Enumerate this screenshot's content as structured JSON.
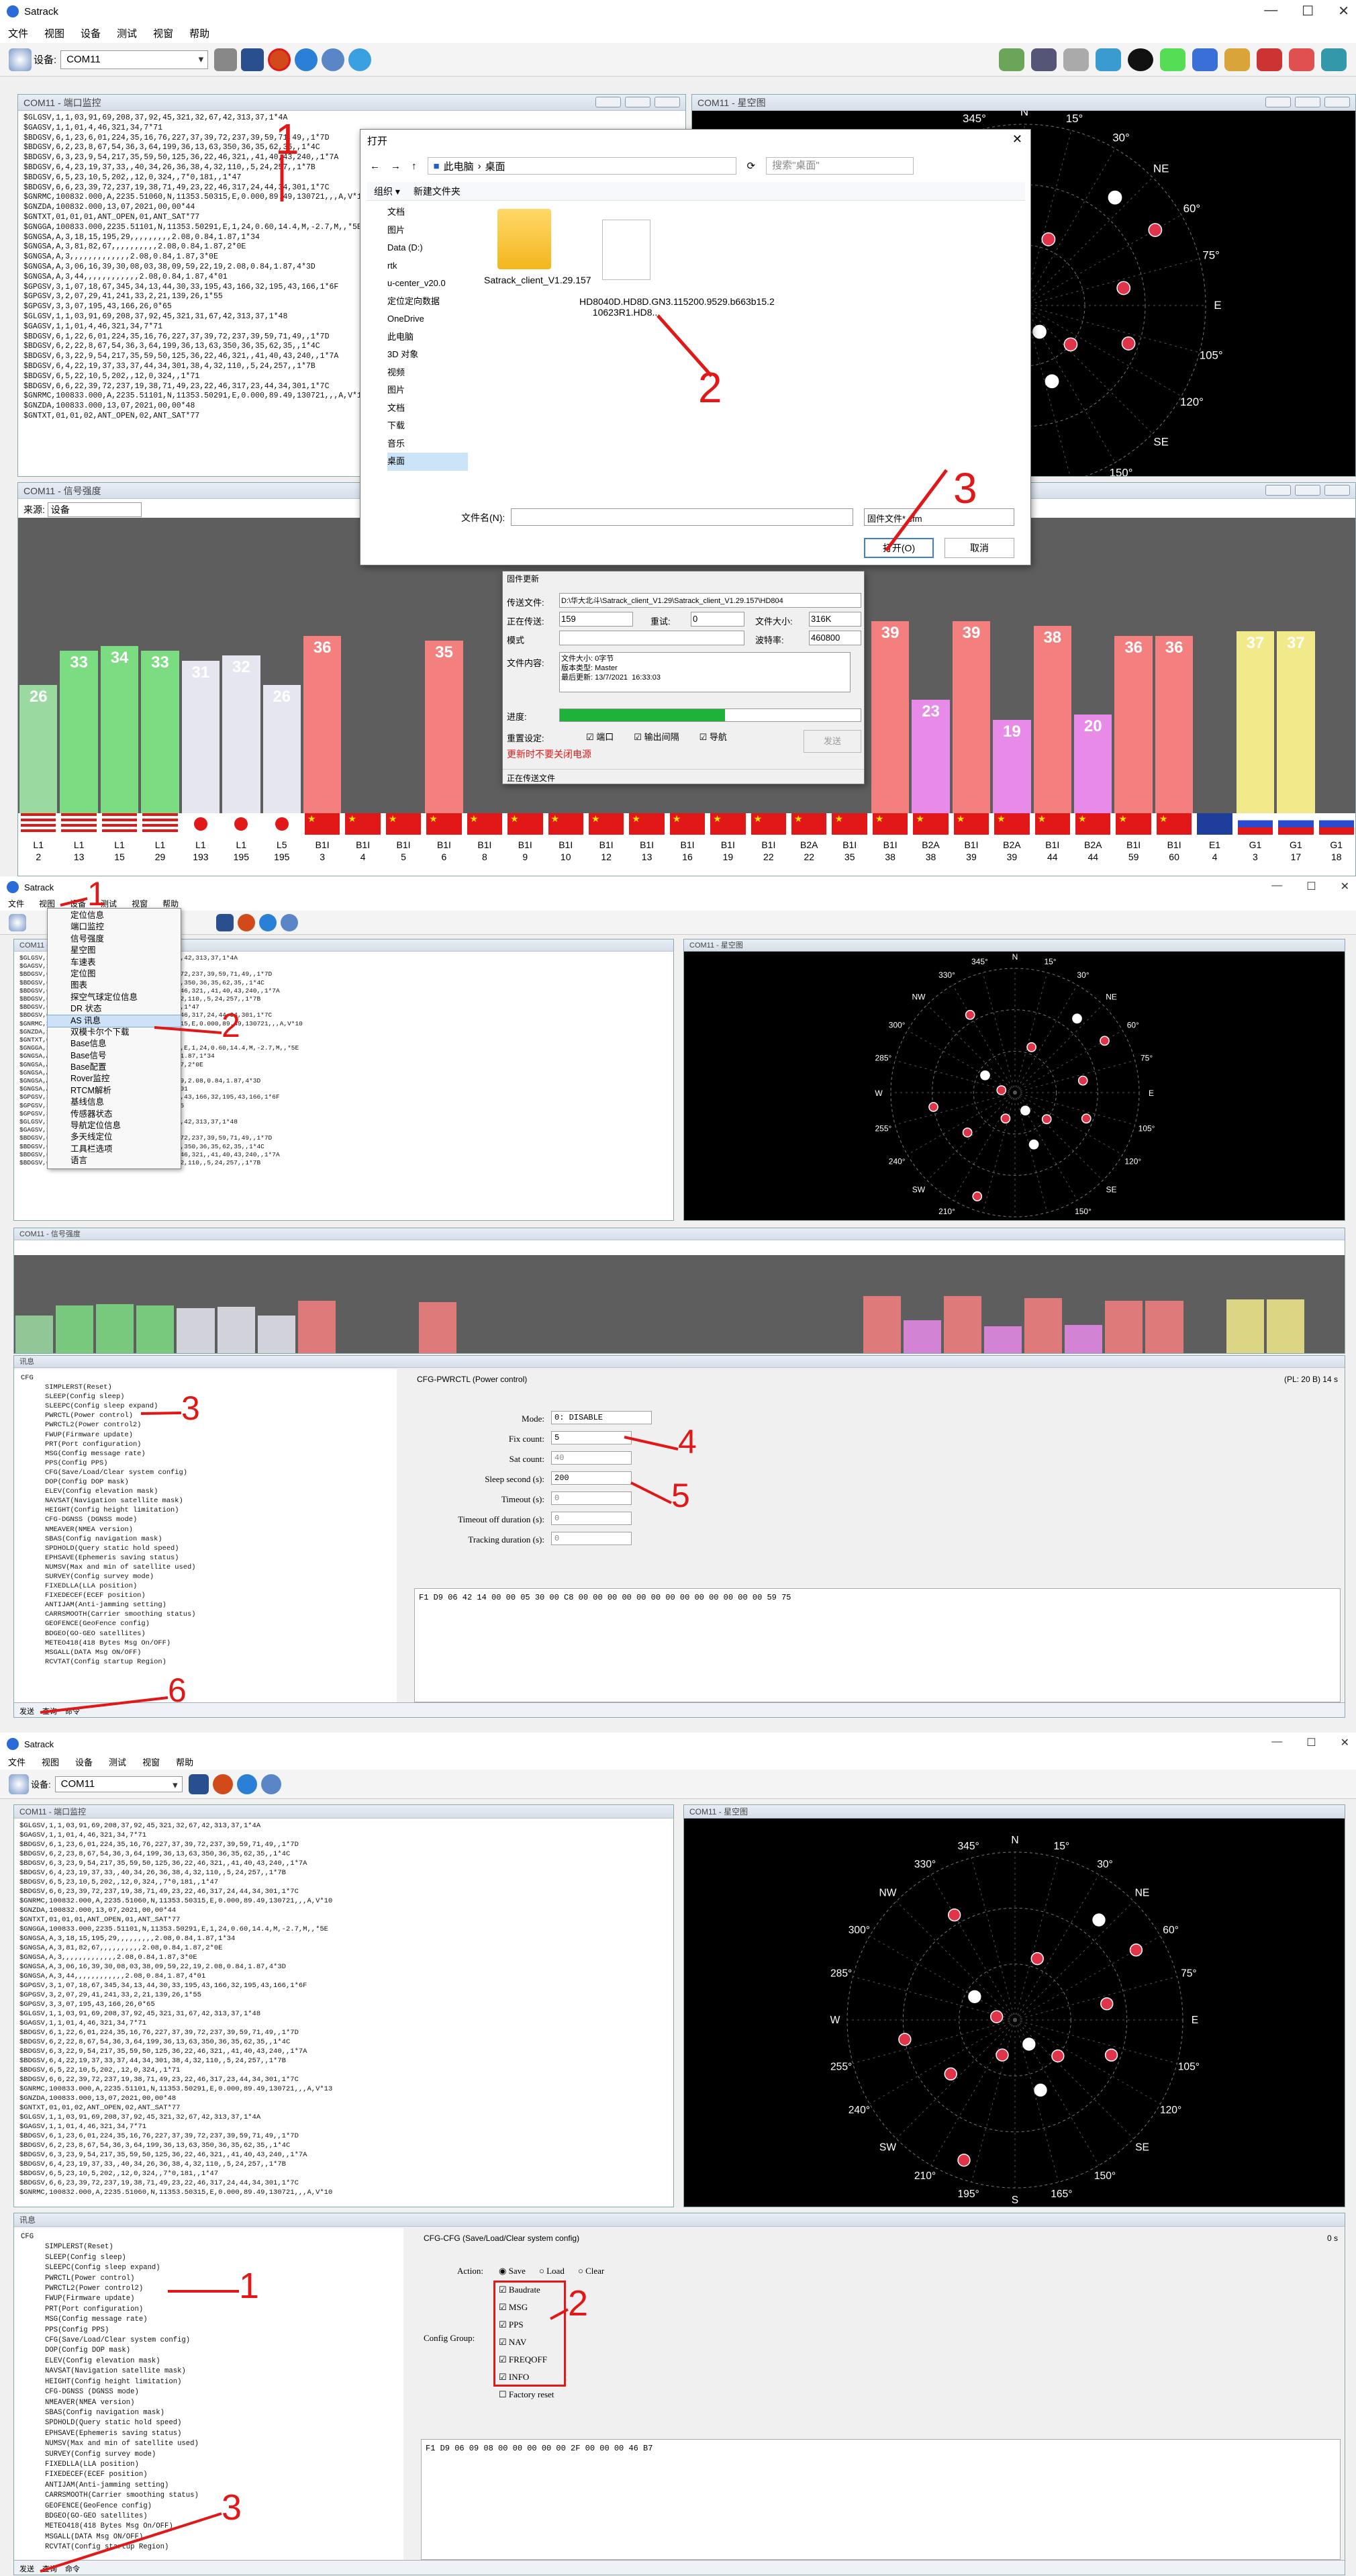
{
  "app": {
    "title": "Satrack",
    "menu": [
      "文件",
      "视图",
      "设备",
      "测试",
      "视窗",
      "帮助"
    ],
    "device_label": "设备:",
    "device_value": "COM11"
  },
  "panels": {
    "nmea_title": "COM11 - 端口监控",
    "sky_title": "COM11 - 星空图",
    "signal_title": "COM11 - 信号强度",
    "signal_source_label": "来源:",
    "signal_source_value": "设备",
    "cfg_title": "讯息"
  },
  "nmea_lines_1": [
    "$GLGSV,1,1,03,91,69,208,37,92,45,321,32,67,42,313,37,1*4A",
    "$GAGSV,1,1,01,4,46,321,34,7*71",
    "$BDGSV,6,1,23,6,01,224,35,16,76,227,37,39,72,237,39,59,71,49,,1*7D",
    "$BDGSV,6,2,23,8,67,54,36,3,64,199,36,13,63,350,36,35,62,35,,1*4C",
    "$BDGSV,6,3,23,9,54,217,35,59,50,125,36,22,46,321,,41,40,43,240,,1*7A",
    "$BDGSV,6,4,23,19,37,33,,40,34,26,36,38,4,32,110,,5,24,257,,1*7B",
    "$BDGSV,6,5,23,10,5,202,,12,0,324,,7*0,181,,1*47",
    "$BDGSV,6,6,23,39,72,237,19,38,71,49,23,22,46,317,24,44,34,301,1*7C",
    "$GNRMC,100832.000,A,2235.51060,N,11353.50315,E,0.000,89.49,130721,,,A,V*10",
    "$GNZDA,100832.000,13,07,2021,00,00*44",
    "$GNTXT,01,01,01,ANT_OPEN,01,ANT_SAT*77",
    "$GNGGA,100833.000,2235.51101,N,11353.50291,E,1,24,0.60,14.4,M,-2.7,M,,*5E",
    "$GNGSA,A,3,18,15,195,29,,,,,,,,,2.08,0.84,1.87,1*34",
    "$GNGSA,A,3,81,82,67,,,,,,,,,,2.08,0.84,1.87,2*0E",
    "$GNGSA,A,3,,,,,,,,,,,,,2.08,0.84,1.87,3*0E",
    "$GNGSA,A,3,06,16,39,30,08,03,38,09,59,22,19,2.08,0.84,1.87,4*3D",
    "$GNGSA,A,3,44,,,,,,,,,,,,2.08,0.84,1.87,4*01",
    "$GPGSV,3,1,07,18,67,345,34,13,44,30,33,195,43,166,32,195,43,166,1*6F",
    "$GPGSV,3,2,07,29,41,241,33,2,21,139,26,1*55",
    "$GPGSV,3,3,07,195,43,166,26,0*65",
    "$GLGSV,1,1,03,91,69,208,37,92,45,321,31,67,42,313,37,1*48",
    "$GAGSV,1,1,01,4,46,321,34,7*71",
    "$BDGSV,6,1,22,6,01,224,35,16,76,227,37,39,72,237,39,59,71,49,,1*7D",
    "$BDGSV,6,2,22,8,67,54,36,3,64,199,36,13,63,350,36,35,62,35,,1*4C",
    "$BDGSV,6,3,22,9,54,217,35,59,50,125,36,22,46,321,,41,40,43,240,,1*7A",
    "$BDGSV,6,4,22,19,37,33,37,44,34,301,38,4,32,110,,5,24,257,,1*7B",
    "$BDGSV,6,5,22,10,5,202,,12,0,324,,1*71",
    "$BDGSV,6,6,22,39,72,237,19,38,71,49,23,22,46,317,23,44,34,301,1*7C",
    "$GNRMC,100833.000,A,2235.51101,N,11353.50291,E,0.000,89.49,130721,,,A,V*13",
    "$GNZDA,100833.000,13,07,2021,00,00*48",
    "$GNTXT,01,01,02,ANT_OPEN,02,ANT_SAT*77"
  ],
  "open_dialog": {
    "title": "打开",
    "path": [
      "此电脑",
      "桌面"
    ],
    "search_placeholder": "搜索\"桌面\"",
    "organize": "组织 ▾",
    "new_folder": "新建文件夹",
    "nav": [
      "文档",
      "图片",
      "Data (D:)",
      "rtk",
      "u-center_v20.0",
      "定位定向数据",
      "OneDrive",
      "此电脑",
      "3D 对象",
      "视频",
      "图片",
      "文档",
      "下载",
      "音乐",
      "桌面"
    ],
    "files": [
      {
        "name": "Satrack_client_V1.29.157"
      },
      {
        "name": "HD8040D.HD8D.GN3.115200.9529.b663b15.2\n10623R1.HD8..."
      }
    ],
    "filename_label": "文件名(N):",
    "filetype": "固件文件*.cfm",
    "open_btn": "打开(O)",
    "cancel_btn": "取消"
  },
  "upgrade_dialog": {
    "title": "固件更新",
    "file_label": "传送文件:",
    "file_path": "D:\\华大北斗\\Satrack_client_V1.29\\Satrack_client_V1.29.157\\HD804",
    "sending_label": "正在传送:",
    "sending": "159",
    "retry_label": "重试:",
    "retry": "0",
    "size_label": "文件大小:",
    "size": "316K",
    "mode_label": "模式",
    "baud_label": "波特率:",
    "baud": "460800",
    "content_label": "文件内容:",
    "content": "文件大小: 0字节\n版本类型: Master\n最后更新: 13/7/2021  16:33:03",
    "progress_label": "进度:",
    "progress": 0.55,
    "reset_label": "重置设定:",
    "opt_port": "端口",
    "opt_output": "输出间隔",
    "opt_nav": "导航",
    "send_btn": "发送",
    "warning": "更新时不要关闭电源",
    "footer": "正在传送文件"
  },
  "signal_1": [
    {
      "v": 26,
      "c": "#9ad9a0",
      "sys": "L1",
      "n": "2",
      "f": "us"
    },
    {
      "v": 33,
      "c": "#7cdc82",
      "sys": "L1",
      "n": "13",
      "f": "us"
    },
    {
      "v": 34,
      "c": "#7cdc82",
      "sys": "L1",
      "n": "15",
      "f": "us"
    },
    {
      "v": 33,
      "c": "#7cdc82",
      "sys": "L1",
      "n": "29",
      "f": "us"
    },
    {
      "v": 31,
      "c": "#e6e6f0",
      "sys": "L1",
      "n": "193",
      "f": "jp"
    },
    {
      "v": 32,
      "c": "#e6e6f0",
      "sys": "L1",
      "n": "195",
      "f": "jp"
    },
    {
      "v": 26,
      "c": "#e6e6f0",
      "sys": "L5",
      "n": "195",
      "f": "jp"
    },
    {
      "v": 36,
      "c": "#f47f7f",
      "sys": "B1I",
      "n": "3",
      "f": "cn"
    },
    {
      "v": 0,
      "c": "#f47f7f",
      "sys": "B1I",
      "n": "4",
      "f": "cn"
    },
    {
      "v": 0,
      "c": "#f47f7f",
      "sys": "B1I",
      "n": "5",
      "f": "cn"
    },
    {
      "v": 35,
      "c": "#f47f7f",
      "sys": "B1I",
      "n": "6",
      "f": "cn"
    },
    {
      "v": 0,
      "c": "#f47f7f",
      "sys": "B1I",
      "n": "8",
      "f": "cn"
    },
    {
      "v": 0,
      "c": "#f47f7f",
      "sys": "B1I",
      "n": "9",
      "f": "cn"
    },
    {
      "v": 0,
      "c": "#f47f7f",
      "sys": "B1I",
      "n": "10",
      "f": "cn"
    },
    {
      "v": 0,
      "c": "#f47f7f",
      "sys": "B1I",
      "n": "12",
      "f": "cn"
    },
    {
      "v": 0,
      "c": "#f47f7f",
      "sys": "B1I",
      "n": "13",
      "f": "cn"
    },
    {
      "v": 0,
      "c": "#f47f7f",
      "sys": "B1I",
      "n": "16",
      "f": "cn"
    },
    {
      "v": 0,
      "c": "#f47f7f",
      "sys": "B1I",
      "n": "19",
      "f": "cn"
    },
    {
      "v": 0,
      "c": "#f47f7f",
      "sys": "B1I",
      "n": "22",
      "f": "cn"
    },
    {
      "v": 0,
      "c": "#f47f7f",
      "sys": "B2A",
      "n": "22",
      "f": "cn"
    },
    {
      "v": 0,
      "c": "#f47f7f",
      "sys": "B1I",
      "n": "35",
      "f": "cn"
    },
    {
      "v": 39,
      "c": "#f47f7f",
      "sys": "B1I",
      "n": "38",
      "f": "cn"
    },
    {
      "v": 23,
      "c": "#e88ae8",
      "sys": "B2A",
      "n": "38",
      "f": "cn"
    },
    {
      "v": 39,
      "c": "#f47f7f",
      "sys": "B1I",
      "n": "39",
      "f": "cn"
    },
    {
      "v": 19,
      "c": "#e88ae8",
      "sys": "B2A",
      "n": "39",
      "f": "cn"
    },
    {
      "v": 38,
      "c": "#f47f7f",
      "sys": "B1I",
      "n": "44",
      "f": "cn"
    },
    {
      "v": 20,
      "c": "#e88ae8",
      "sys": "B2A",
      "n": "44",
      "f": "cn"
    },
    {
      "v": 36,
      "c": "#f47f7f",
      "sys": "B1I",
      "n": "59",
      "f": "cn"
    },
    {
      "v": 36,
      "c": "#f47f7f",
      "sys": "B1I",
      "n": "60",
      "f": "cn"
    },
    {
      "v": 0,
      "c": "#7d8ad8",
      "sys": "E1",
      "n": "4",
      "f": "eu"
    },
    {
      "v": 37,
      "c": "#f2ea8a",
      "sys": "G1",
      "n": "3",
      "f": "ru"
    },
    {
      "v": 37,
      "c": "#f2ea8a",
      "sys": "G1",
      "n": "17",
      "f": "ru"
    },
    {
      "v": 0,
      "c": "#f2ea8a",
      "sys": "G1",
      "n": "18",
      "f": "ru"
    }
  ],
  "view_menu": [
    "定位信息",
    "端口监控",
    "信号强度",
    "星空图",
    "车速表",
    "定位图",
    "图表",
    "探空气球定位信息",
    "DR 状态",
    "AS 讯息",
    "双模卡尔个下载",
    "Base信息",
    "Base信号",
    "Base配置",
    "Rover监控",
    "RTCM解析",
    "基线信息",
    "传感器状态",
    "导航定位信息",
    "多天线定位",
    "工具栏选项",
    "语言"
  ],
  "cfg_tree": [
    "CFG",
    "SIMPLERST(Reset)",
    "SLEEP(Config sleep)",
    "SLEEPC(Config sleep expand)",
    "PWRCTL(Power control)",
    "PWRCTL2(Power control2)",
    "FWUP(Firmware update)",
    "PRT(Port configuration)",
    "MSG(Config message rate)",
    "PPS(Config PPS)",
    "CFG(Save/Load/Clear system config)",
    "DOP(Config DOP mask)",
    "ELEV(Config elevation mask)",
    "NAVSAT(Navigation satellite mask)",
    "HEIGHT(Config height limitation)",
    "CFG-DGNSS (DGNSS mode)",
    "NMEAVER(NMEA version)",
    "SBAS(Config navigation mask)",
    "SPDHOLD(Query static hold speed)",
    "EPHSAVE(Ephemeris saving status)",
    "NUMSV(Max and min of satellite used)",
    "SURVEY(Config survey mode)",
    "FIXEDLLA(LLA position)",
    "FIXEDECEF(ECEF position)",
    "ANTIJAM(Anti-jamming setting)",
    "CARRSMOOTH(Carrier smoothing status)",
    "GEOFENCE(GeoFence config)",
    "BDGEO(GO-GEO satellites)",
    "METEO418(418 Bytes Msg On/OFF)",
    "MSGALL(DATA Msg ON/OFF)",
    "RCVTAT(Config startup Region)"
  ],
  "pwrctl": {
    "header": "CFG-PWRCTL (Power control)",
    "pl": "(PL: 20 B)  14 s",
    "mode_label": "Mode:",
    "mode": "0: DISABLE",
    "fix_label": "Fix count:",
    "fix": "5",
    "sat_label": "Sat count:",
    "sat": "40",
    "sleep_label": "Sleep second (s):",
    "sleep": "200",
    "timeout_label": "Timeout (s):",
    "timeout": "0",
    "toff_label": "Timeout off duration (s):",
    "toff": "0",
    "track_label": "Tracking duration (s):",
    "track": "0",
    "hex": "F1 D9 06 42 14 00 00 05 30 00 C8 00 00 00 00 00 00 00 00 00 00 00 00 00 59 75"
  },
  "cfgcfg": {
    "header": "CFG-CFG (Save/Load/Clear system config)",
    "pl": "0 s",
    "action_label": "Action:",
    "action_opts": [
      "Save",
      "Load",
      "Clear"
    ],
    "group_label": "Config Group:",
    "groups": [
      "Baudrate",
      "MSG",
      "PPS",
      "NAV",
      "FREQOFF",
      "INFO",
      "Factory reset"
    ],
    "hex": "F1 D9 06 09 08 00 00 00 00 00 2F 00 00 00 46 B7"
  },
  "send_bar": {
    "send": "发送",
    "query": "查询",
    "cmd": "命令"
  },
  "annotations": {
    "n1": "1",
    "n2": "2",
    "n3": "3",
    "n4": "4",
    "n5": "5",
    "n6": "6"
  },
  "sky_labels": [
    "E",
    "N",
    "S",
    "W",
    "NE",
    "SE",
    "SW",
    "NW",
    "30°",
    "60°",
    "75°",
    "105°",
    "120°",
    "150°",
    "165°",
    "195°",
    "210°",
    "240°",
    "255°",
    "285°",
    "300°",
    "330°",
    "345°",
    "15°"
  ]
}
